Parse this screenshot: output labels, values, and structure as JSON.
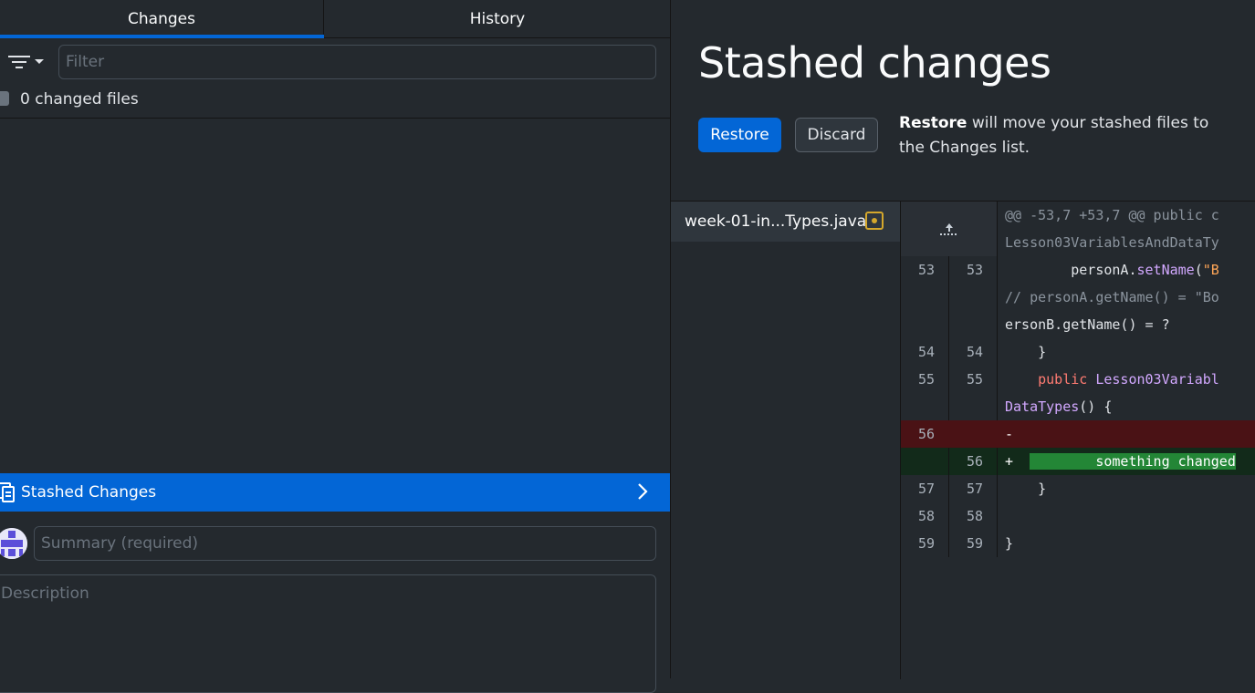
{
  "tabs": {
    "changes": "Changes",
    "history": "History"
  },
  "filter": {
    "placeholder": "Filter"
  },
  "changes_list": {
    "count_label": "0 changed files"
  },
  "stash_bar": {
    "label": "Stashed Changes"
  },
  "commit": {
    "summary_placeholder": "Summary (required)",
    "description_placeholder": "Description"
  },
  "stash_panel": {
    "title": "Stashed changes",
    "restore_label": "Restore",
    "discard_label": "Discard",
    "note_bold": "Restore",
    "note_rest": " will move your stashed files to the Changes list."
  },
  "file_list": {
    "items": [
      {
        "name": "week-01-in...Types.java",
        "status": "modified"
      }
    ]
  },
  "diff": {
    "hunk_header": "@@ -53,7 +53,7 @@ public c",
    "hunk_context": "Lesson03VariablesAndDataTy",
    "rows": [
      {
        "old": "53",
        "new": "53",
        "code": "        personA.setName(\"B"
      },
      {
        "old": "",
        "new": "",
        "code": "// personA.getName() = \"Bo"
      },
      {
        "old": "",
        "new": "",
        "code": "ersonB.getName() = ?"
      },
      {
        "old": "54",
        "new": "54",
        "code": "    }"
      },
      {
        "old": "55",
        "new": "55",
        "code": "    public Lesson03Variabl"
      },
      {
        "old": "",
        "new": "",
        "code": "DataTypes() {"
      },
      {
        "old": "56",
        "new": "",
        "code": "-",
        "type": "del"
      },
      {
        "old": "",
        "new": "56",
        "code": "+",
        "added_text": "        something changed",
        "type": "add"
      },
      {
        "old": "57",
        "new": "57",
        "code": "    }"
      },
      {
        "old": "58",
        "new": "58",
        "code": ""
      },
      {
        "old": "59",
        "new": "59",
        "code": "}"
      }
    ]
  },
  "colors": {
    "accent": "#0366d6",
    "background": "#24292e",
    "deleted_row": "#4a1215",
    "added_row": "#122a1a",
    "added_highlight": "#238636",
    "modified_badge": "#d4a72c"
  }
}
